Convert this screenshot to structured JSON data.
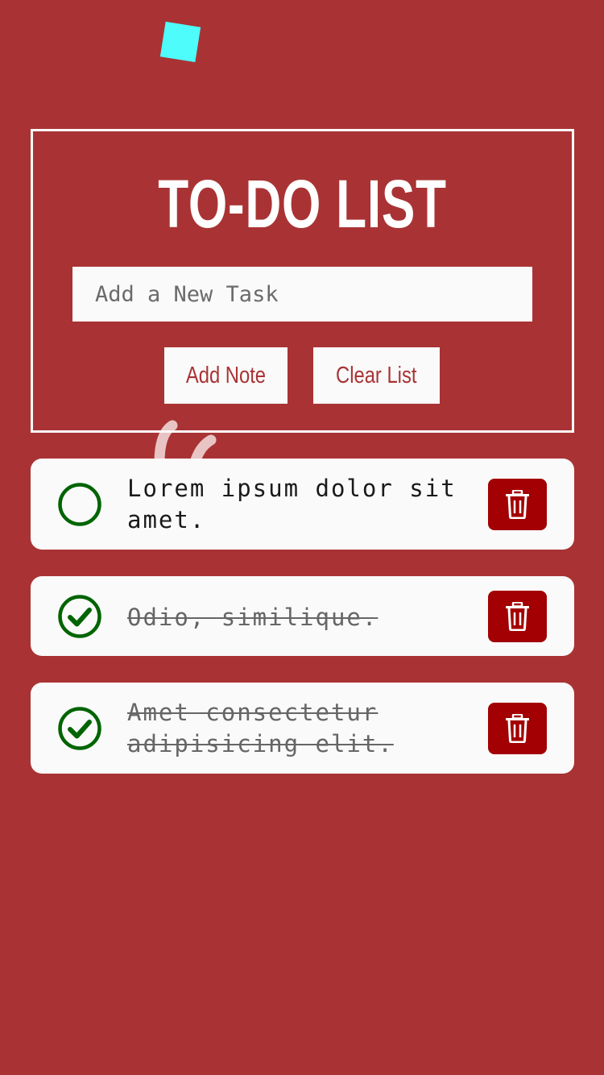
{
  "header": {
    "title": "TO-DO LIST",
    "input_placeholder": "Add a New Task",
    "add_label": "Add Note",
    "clear_label": "Clear List"
  },
  "tasks": [
    {
      "text": "Lorem ipsum dolor sit amet.",
      "completed": false
    },
    {
      "text": "Odio, similique.",
      "completed": true
    },
    {
      "text": "Amet consectetur adipisicing elit.",
      "completed": true
    }
  ],
  "colors": {
    "background": "#a93334",
    "panel_border": "#fafafa",
    "card": "#fafafa",
    "check_green": "#006400",
    "delete_red": "#a30003",
    "confetti": "#4efcfc"
  },
  "icons": {
    "unchecked": "circle-icon",
    "checked": "check-circle-icon",
    "delete": "trash-icon"
  }
}
